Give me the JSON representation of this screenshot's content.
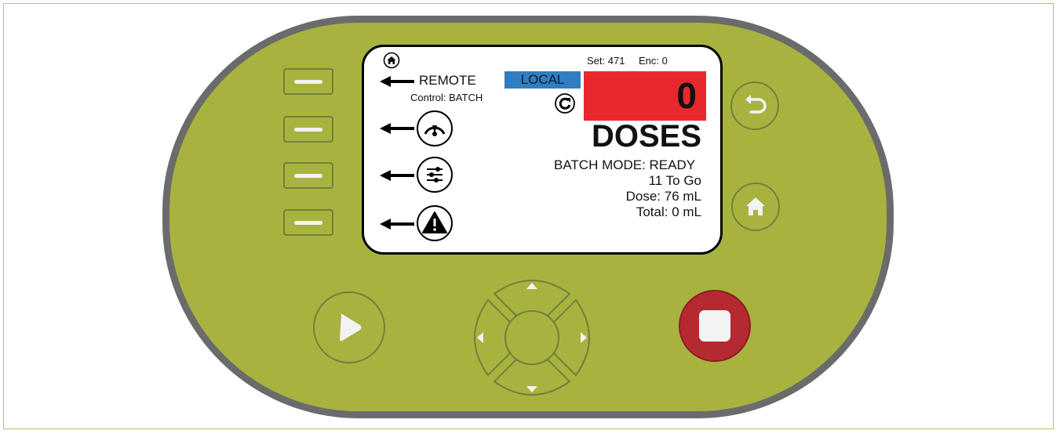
{
  "screen": {
    "set_label": "Set: 471",
    "enc_label": "Enc: 0",
    "mode_remote": "REMOTE",
    "control_label": "Control: BATCH",
    "local_label": "LOCAL",
    "count_value": "0",
    "units_label": "DOSES",
    "batch_status": "BATCH MODE: READY",
    "to_go": "11 To Go",
    "dose": "Dose: 76 mL",
    "total": "Total: 0 mL"
  },
  "menu_items": [
    {
      "icon": "gauge-icon"
    },
    {
      "icon": "sliders-icon"
    },
    {
      "icon": "warning-icon"
    }
  ],
  "colors": {
    "body": "#a8b23f",
    "bezel": "#6b6b6b",
    "local_bg": "#2f7ec1",
    "count_bg": "#e8282c",
    "stop_button": "#b52a30"
  }
}
